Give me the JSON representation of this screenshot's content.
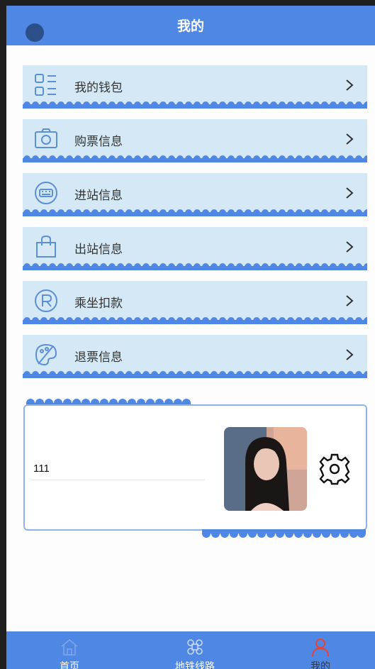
{
  "header": {
    "title": "我的"
  },
  "menu": [
    {
      "label": "我的钱包",
      "icon": "list-grid-icon"
    },
    {
      "label": "购票信息",
      "icon": "camera-icon"
    },
    {
      "label": "进站信息",
      "icon": "keyboard-icon"
    },
    {
      "label": "出站信息",
      "icon": "shopping-bag-icon"
    },
    {
      "label": "乘坐扣款",
      "icon": "registered-icon"
    },
    {
      "label": "退票信息",
      "icon": "palette-icon"
    }
  ],
  "profile": {
    "value": "111",
    "avatar": "profile-photo",
    "settings_icon": "gear-icon"
  },
  "tabs": [
    {
      "label": "首页",
      "icon": "home-icon"
    },
    {
      "label": "地铁线路",
      "icon": "command-icon"
    },
    {
      "label": "我的",
      "icon": "user-icon"
    }
  ],
  "colors": {
    "primary": "#4f87e4",
    "item_bg": "#d4e9f5",
    "active_tab": "#e2443b",
    "icon_stroke": "#5b8fd6"
  }
}
